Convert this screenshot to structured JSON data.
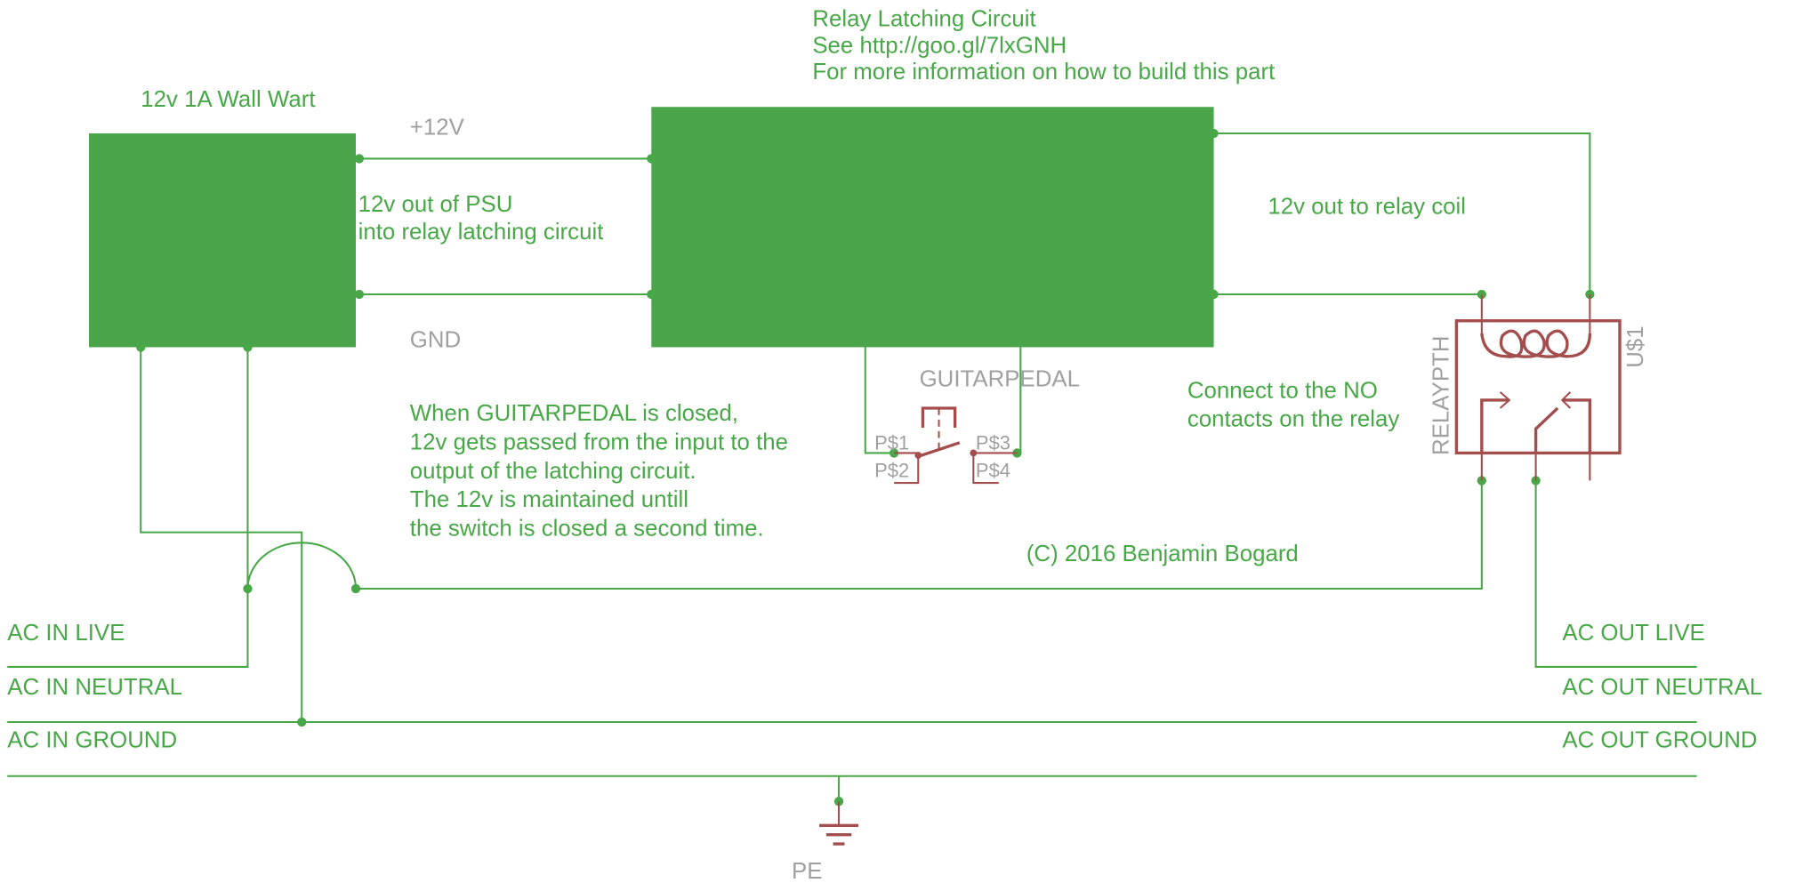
{
  "colors": {
    "wire": "#48a848",
    "block": "#4aa54a",
    "symbol": "#a34d4d",
    "label": "#a0a0a0"
  },
  "psu": {
    "title": "12v 1A Wall Wart"
  },
  "nets": {
    "plus12": "+12V",
    "gnd": "GND",
    "pe": "PE"
  },
  "psu_note": [
    "12v out of PSU",
    "into relay latching circuit"
  ],
  "latch": {
    "lines": [
      "Relay Latching Circuit",
      "See http://goo.gl/7lxGNH",
      "For more information on how to build this part"
    ]
  },
  "coil_note": "12v out to relay coil",
  "pedal": {
    "name": "GUITARPEDAL",
    "pins": [
      "P$1",
      "P$2",
      "P$3",
      "P$4"
    ]
  },
  "pedal_note": [
    "When GUITARPEDAL is closed,",
    "12v gets passed from the input to the",
    " output of the latching circuit.",
    "The 12v is maintained untill",
    "the switch is closed a second time."
  ],
  "relay": {
    "value": "RELAYPTH",
    "name": "U$1",
    "note": [
      "Connect to the NO",
      "contacts on the relay"
    ]
  },
  "copyright": "(C) 2016 Benjamin Bogard",
  "ac_in": [
    "AC IN LIVE",
    "AC IN NEUTRAL",
    "AC IN GROUND"
  ],
  "ac_out": [
    "AC OUT LIVE",
    "AC OUT NEUTRAL",
    "AC OUT GROUND"
  ]
}
